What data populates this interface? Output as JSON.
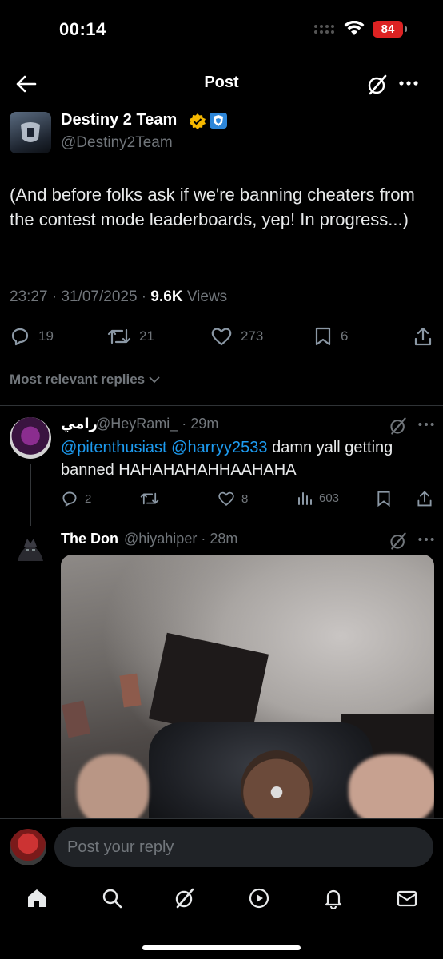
{
  "status_bar": {
    "time": "00:14",
    "battery": "84"
  },
  "header": {
    "title": "Post"
  },
  "tweet": {
    "author_name": "Destiny 2 Team",
    "author_handle": "@Destiny2Team",
    "text": "(And before folks ask if we're banning cheaters from the contest mode leaderboards, yep! In progress...)",
    "time": "23:27 · 31/07/2025 · ",
    "views_count": "9.6K",
    "views_label": " Views",
    "replies": "19",
    "reposts": "21",
    "likes": "273",
    "bookmarks": "6"
  },
  "replies_filter_label": "Most relevant replies",
  "reply_1": {
    "name": "رامي",
    "handle_time": "@HeyRami_ · 29m",
    "mention_1": "@pitenthusiast",
    "mention_2": "@harryy2533",
    "text": " damn yall getting banned HAHAHAHAHHAAHAHA",
    "replies": "2",
    "likes": "8",
    "views": "603"
  },
  "reply_2": {
    "name": "The Don",
    "handle_time": "@hiyahiper · 28m"
  },
  "compose": {
    "placeholder": "Post your reply"
  },
  "colors": {
    "accent": "#1d9bf0",
    "background": "#000000",
    "muted": "#71767b",
    "verified": "#f5b800",
    "battery": "#dd2222"
  },
  "icons": [
    "back-arrow-icon",
    "grok-icon",
    "more-icon",
    "verified-icon",
    "affiliate-badge-icon",
    "reply-icon",
    "repost-icon",
    "like-icon",
    "bookmark-icon",
    "share-icon",
    "views-icon",
    "chevron-down-icon",
    "home-icon",
    "search-icon",
    "play-icon",
    "bell-icon",
    "mail-icon"
  ]
}
